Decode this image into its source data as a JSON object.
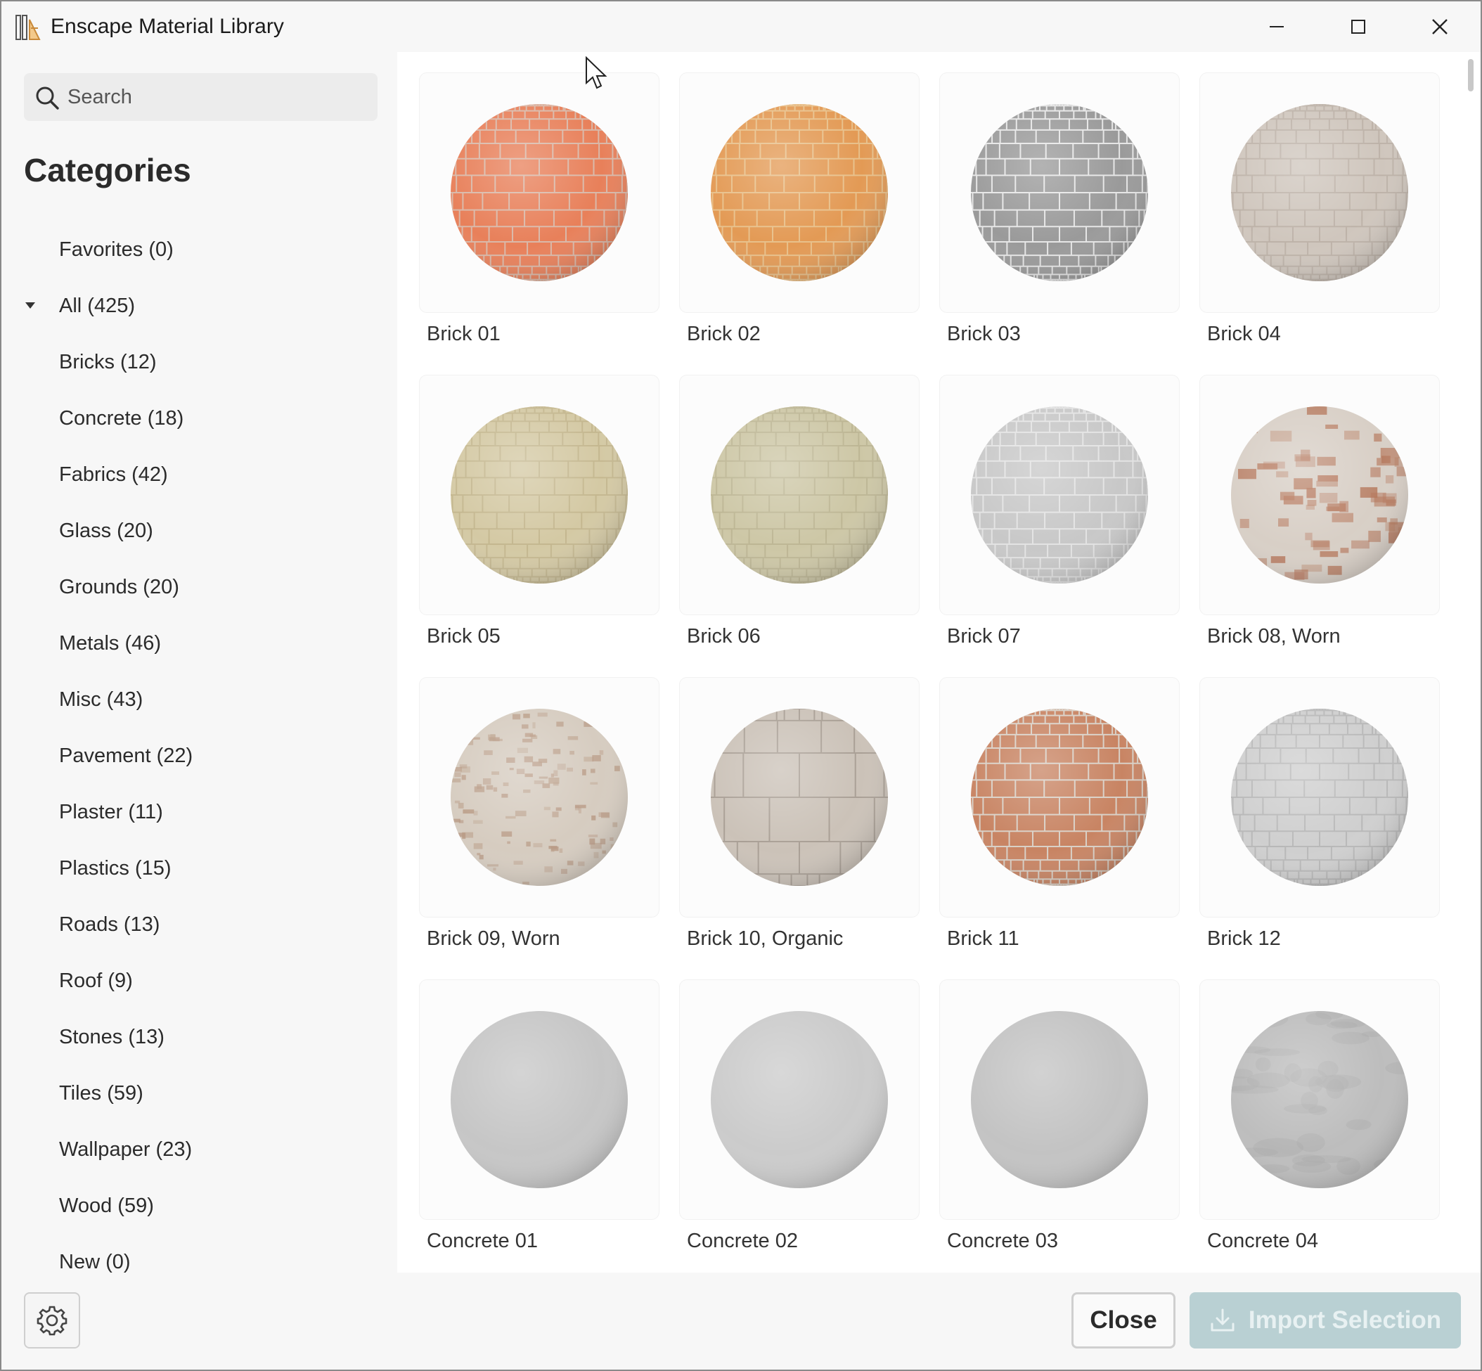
{
  "window": {
    "title": "Enscape Material Library"
  },
  "search": {
    "placeholder": "Search"
  },
  "sidebar": {
    "heading": "Categories",
    "items": [
      {
        "label": "Favorites (0)",
        "expandable": false
      },
      {
        "label": "All (425)",
        "expandable": true
      },
      {
        "label": "Bricks (12)",
        "expandable": false
      },
      {
        "label": "Concrete (18)",
        "expandable": false
      },
      {
        "label": "Fabrics (42)",
        "expandable": false
      },
      {
        "label": "Glass (20)",
        "expandable": false
      },
      {
        "label": "Grounds (20)",
        "expandable": false
      },
      {
        "label": "Metals (46)",
        "expandable": false
      },
      {
        "label": "Misc (43)",
        "expandable": false
      },
      {
        "label": "Pavement (22)",
        "expandable": false
      },
      {
        "label": "Plaster (11)",
        "expandable": false
      },
      {
        "label": "Plastics (15)",
        "expandable": false
      },
      {
        "label": "Roads (13)",
        "expandable": false
      },
      {
        "label": "Roof (9)",
        "expandable": false
      },
      {
        "label": "Stones (13)",
        "expandable": false
      },
      {
        "label": "Tiles (59)",
        "expandable": false
      },
      {
        "label": "Wallpaper (23)",
        "expandable": false
      },
      {
        "label": "Wood (59)",
        "expandable": false
      },
      {
        "label": "New (0)",
        "expandable": false
      }
    ]
  },
  "materials": [
    {
      "name": "Brick 01",
      "base": "#e8805a",
      "mortar": "#d9b8a8",
      "pattern": "brick"
    },
    {
      "name": "Brick 02",
      "base": "#e39a55",
      "mortar": "#e8c08a",
      "pattern": "brick"
    },
    {
      "name": "Brick 03",
      "base": "#9a9a9a",
      "mortar": "#e6e6e6",
      "pattern": "brick"
    },
    {
      "name": "Brick 04",
      "base": "#cfc6bd",
      "mortar": "#bdb2a8",
      "pattern": "brick"
    },
    {
      "name": "Brick 05",
      "base": "#d4c9a4",
      "mortar": "#c4b78f",
      "pattern": "brick"
    },
    {
      "name": "Brick 06",
      "base": "#cdc7a6",
      "mortar": "#bdb694",
      "pattern": "brick"
    },
    {
      "name": "Brick 07",
      "base": "#c8c8c8",
      "mortar": "#e3e3e3",
      "pattern": "brick"
    },
    {
      "name": "Brick 08, Worn",
      "base": "#d8cfc6",
      "mortar": "#b5765a",
      "pattern": "worn"
    },
    {
      "name": "Brick 09, Worn",
      "base": "#d6ccc0",
      "mortar": "#b89a84",
      "pattern": "speckle"
    },
    {
      "name": "Brick 10, Organic",
      "base": "#cbc2b8",
      "mortar": "#a99f95",
      "pattern": "block"
    },
    {
      "name": "Brick 11",
      "base": "#c88463",
      "mortar": "#d9d0c6",
      "pattern": "brick"
    },
    {
      "name": "Brick 12",
      "base": "#cfcfcf",
      "mortar": "#b8b8b8",
      "pattern": "brick"
    },
    {
      "name": "Concrete 01",
      "base": "#c6c6c6",
      "mortar": "#c6c6c6",
      "pattern": "plain"
    },
    {
      "name": "Concrete 02",
      "base": "#cbcbcb",
      "mortar": "#cbcbcb",
      "pattern": "plain"
    },
    {
      "name": "Concrete 03",
      "base": "#c3c3c3",
      "mortar": "#c3c3c3",
      "pattern": "plain"
    },
    {
      "name": "Concrete 04",
      "base": "#bdbdbd",
      "mortar": "#a8a8a8",
      "pattern": "marble"
    }
  ],
  "footer": {
    "close_label": "Close",
    "import_label": "Import Selection"
  },
  "colors": {
    "accent_disabled": "#b9d0d3",
    "background": "#f7f7f7"
  }
}
